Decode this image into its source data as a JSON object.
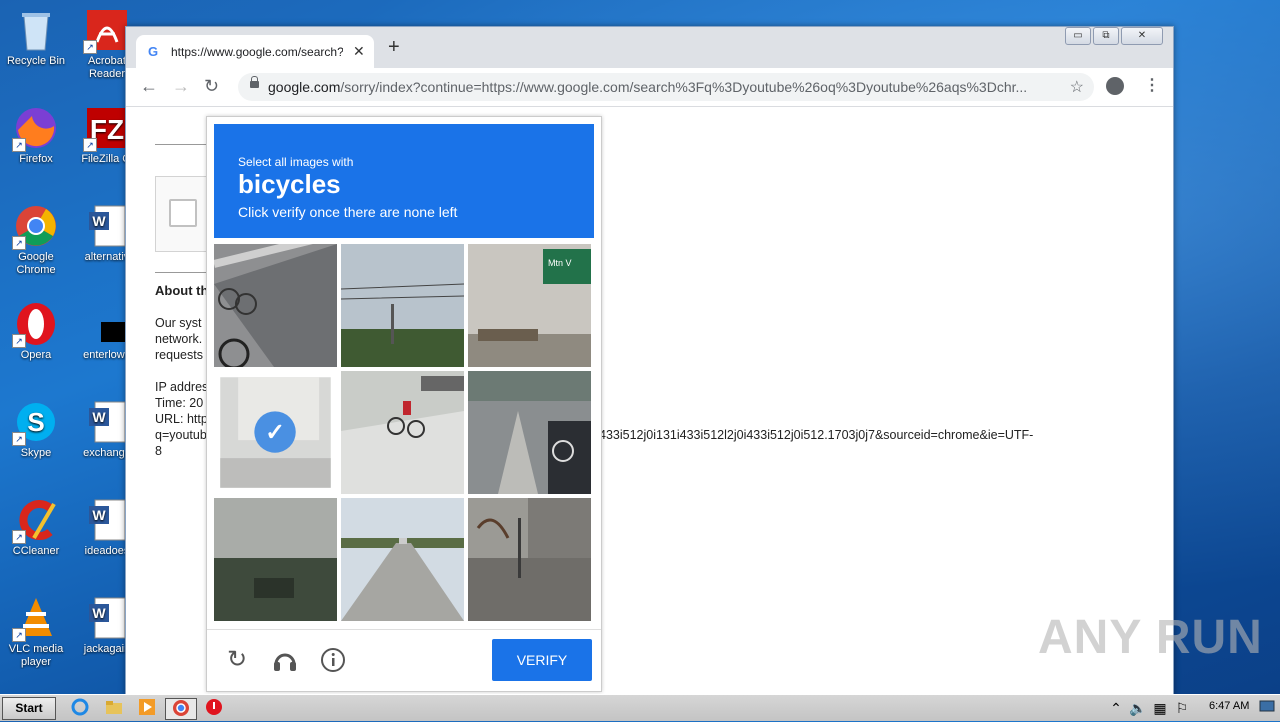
{
  "desktop": {
    "col1": [
      {
        "label": "Recycle Bin",
        "icon": "recycle-bin-icon"
      },
      {
        "label": "Firefox",
        "icon": "firefox-icon"
      },
      {
        "label": "Google Chrome",
        "icon": "chrome-icon"
      },
      {
        "label": "Opera",
        "icon": "opera-icon"
      },
      {
        "label": "Skype",
        "icon": "skype-icon"
      },
      {
        "label": "CCleaner",
        "icon": "ccleaner-icon"
      },
      {
        "label": "VLC media player",
        "icon": "vlc-icon"
      }
    ],
    "col2": [
      {
        "label": "Acrobat Reader",
        "icon": "acrobat-icon"
      },
      {
        "label": "FileZilla Cl",
        "icon": "filezilla-icon"
      },
      {
        "label": "alternativ",
        "icon": "word-doc-icon"
      },
      {
        "label": "enterlowe",
        "icon": "black-file-icon"
      },
      {
        "label": "exchange",
        "icon": "word-doc-icon"
      },
      {
        "label": "ideadoes",
        "icon": "word-doc-icon"
      },
      {
        "label": "jackagain",
        "icon": "word-doc-icon"
      }
    ]
  },
  "browser": {
    "tab_title": "https://www.google.com/search?q=",
    "url_host": "google.com",
    "url_rest": "/sorry/index?continue=https://www.google.com/search%3Fq%3Dyoutube%26oq%3Dyoutube%26aqs%3Dchr...",
    "win_min": "▭",
    "win_max": "⧉",
    "win_close": "✕"
  },
  "page": {
    "about_heading": "About th",
    "line1": "Our syst",
    "line2": "network.",
    "line3": "requests",
    "ip_label": "IP addres",
    "time_label": "Time: 20",
    "url_label": "URL: http",
    "url_cont": "q=youtub",
    "url_tail": "433i512j0i131i433i512l2j0i433i512j0i512.1703j0j7&sourceid=chrome&ie=UTF-",
    "url_end": "8"
  },
  "captcha": {
    "instruction_small": "Select all images with",
    "target": "bicycles",
    "instruction_sub": "Click verify once there are none left",
    "selected_tile": 3,
    "verify_label": "VERIFY"
  },
  "watermark": "ANY RUN",
  "taskbar": {
    "start_label": "Start",
    "clock": "6:47 AM"
  }
}
